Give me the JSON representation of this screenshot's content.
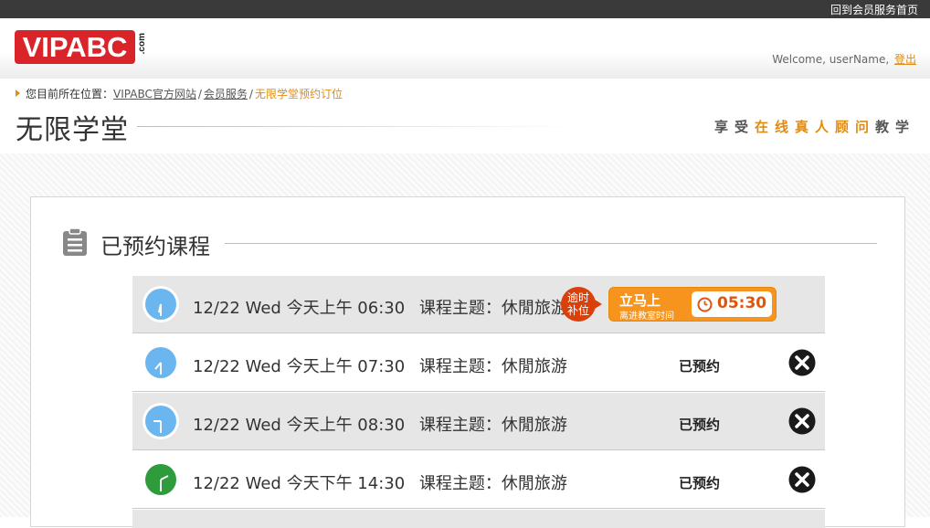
{
  "top_bar": {
    "link": "回到会员服务首页"
  },
  "header": {
    "logo_text": "VIPABC",
    "logo_suffix": ".com",
    "welcome_prefix": "Welcome,",
    "username": "userName,",
    "logout": "登出"
  },
  "breadcrumb": {
    "prefix": "您目前所在位置：",
    "items": [
      "VIPABC官方网站",
      "会员服务"
    ],
    "current": "无限学堂预约订位",
    "separator": "/"
  },
  "page": {
    "title": "无限学堂",
    "slogan": {
      "part1": "享受",
      "part2": "在线真人顾问",
      "part3": "教学"
    }
  },
  "section": {
    "title": "已预约课程",
    "icon": "clipboard-icon"
  },
  "colors": {
    "accent": "#e38b0f",
    "brand_red": "#d9242a",
    "clock_blue": "#6bb6ee",
    "clock_green": "#2e9b3d"
  },
  "classes": [
    {
      "date": "12/22 Wed",
      "time": "今天上午 06:30",
      "topic": "课程主题：休閒旅游",
      "clock_color": "blue",
      "badge": [
        "逾时",
        "补位"
      ],
      "enter_label": "立马上",
      "enter_sub": "离进教室时间",
      "countdown": "05:30"
    },
    {
      "date": "12/22 Wed",
      "time": "今天上午 07:30",
      "topic": "课程主题：休閒旅游",
      "clock_color": "blue",
      "status": "已预约"
    },
    {
      "date": "12/22 Wed",
      "time": "今天上午 08:30",
      "topic": "课程主题：休閒旅游",
      "clock_color": "blue",
      "status": "已预约"
    },
    {
      "date": "12/22 Wed",
      "time": "今天下午 14:30",
      "topic": "课程主题：休閒旅游",
      "clock_color": "green",
      "status": "已预约"
    }
  ]
}
